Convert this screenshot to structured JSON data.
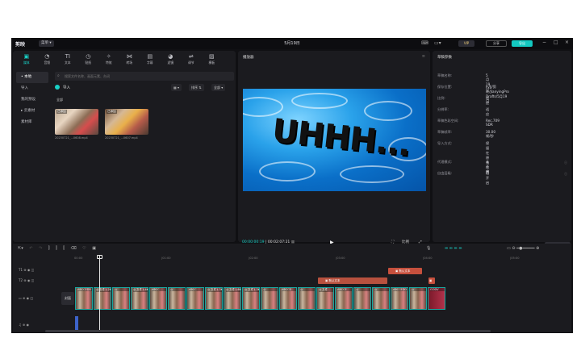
{
  "titlebar": {
    "logo": "剪映",
    "menu": "菜单 ▾",
    "title": "5月19日",
    "vip": "VIP",
    "share": "分享",
    "export": "导出"
  },
  "toolbar": [
    {
      "label": "媒体",
      "icon": "media-icon",
      "glyph": "▣"
    },
    {
      "label": "音频",
      "icon": "audio-icon",
      "glyph": "◔"
    },
    {
      "label": "文本",
      "icon": "text-icon",
      "glyph": "TI"
    },
    {
      "label": "贴纸",
      "icon": "sticker-icon",
      "glyph": "◷"
    },
    {
      "label": "特效",
      "icon": "effects-icon",
      "glyph": "✧"
    },
    {
      "label": "转场",
      "icon": "transition-icon",
      "glyph": "⋈"
    },
    {
      "label": "字幕",
      "icon": "caption-icon",
      "glyph": "▤"
    },
    {
      "label": "滤镜",
      "icon": "filter-icon",
      "glyph": "◕"
    },
    {
      "label": "调节",
      "icon": "adjust-icon",
      "glyph": "⇌"
    },
    {
      "label": "模板",
      "icon": "template-icon",
      "glyph": "▨"
    }
  ],
  "sidenav": [
    "• 本地",
    "导入",
    "我的预设",
    "▸ 云素材",
    "素材库"
  ],
  "media": {
    "search_placeholder": "搜索文件名称、画面元素、台词",
    "import": "导入",
    "sort1": "▦ ▾",
    "sort2": "排序 ⇅",
    "sort3": "全部 ▾",
    "section": "全部",
    "items": [
      {
        "tag": "已添加",
        "caption": "20230721_...0608.mp4"
      },
      {
        "tag": "已添加",
        "caption": "20230721_...0607.mp4"
      }
    ]
  },
  "player": {
    "title": "播放器",
    "overlay_text": "UHHH...",
    "time_current": "00:00:00:19",
    "time_total": "00:02:07:21",
    "ratio": "比例"
  },
  "draft": {
    "title": "草稿参数",
    "rows": [
      {
        "label": "草稿名称:",
        "value": "5月19日"
      },
      {
        "label": "保存位置:",
        "value": "F:/JJ/剪映/JianyingPro Drafts/5月19日"
      },
      {
        "label": "比例:",
        "value": "适应"
      },
      {
        "label": "分辨率:",
        "value": "适应"
      },
      {
        "label": "草稿色彩空间:",
        "value": "Rec.709 SDR"
      },
      {
        "label": "草稿帧率:",
        "value": "30.00帧/秒"
      },
      {
        "label": "导入方式:",
        "value": "保留在原有位置"
      },
      {
        "label": "代理模式:",
        "value": "未开启"
      },
      {
        "label": "自由层级:",
        "value": "已开启"
      }
    ],
    "modify": "修改"
  },
  "timeline": {
    "ticks": [
      "00:00",
      "|01:00",
      "|02:00",
      "|03:00",
      "|04:00",
      "|05:00"
    ],
    "tracks": [
      "T1",
      "T2",
      "▭",
      "♫"
    ],
    "cover": "封面",
    "top_clips": [
      {
        "label": "▣ 默认文本"
      },
      {
        "label": "▣ 默认文本"
      },
      {
        "label": "▣"
      }
    ],
    "clips": [
      "A9CCEDD",
      "◎ 文件1.2KB",
      "◎",
      "◎ 文件1.4K",
      "A9CC",
      "◎",
      "A9CC",
      "◎ 文件1.3KB",
      "◎ 文件1.6K",
      "◎ 文件1.3K",
      "◎",
      "A9CCD",
      "◎",
      "◎ 文件",
      "A9CCE",
      "◎",
      "◎",
      "A9CCEDD",
      "◎",
      "GODV"
    ]
  }
}
